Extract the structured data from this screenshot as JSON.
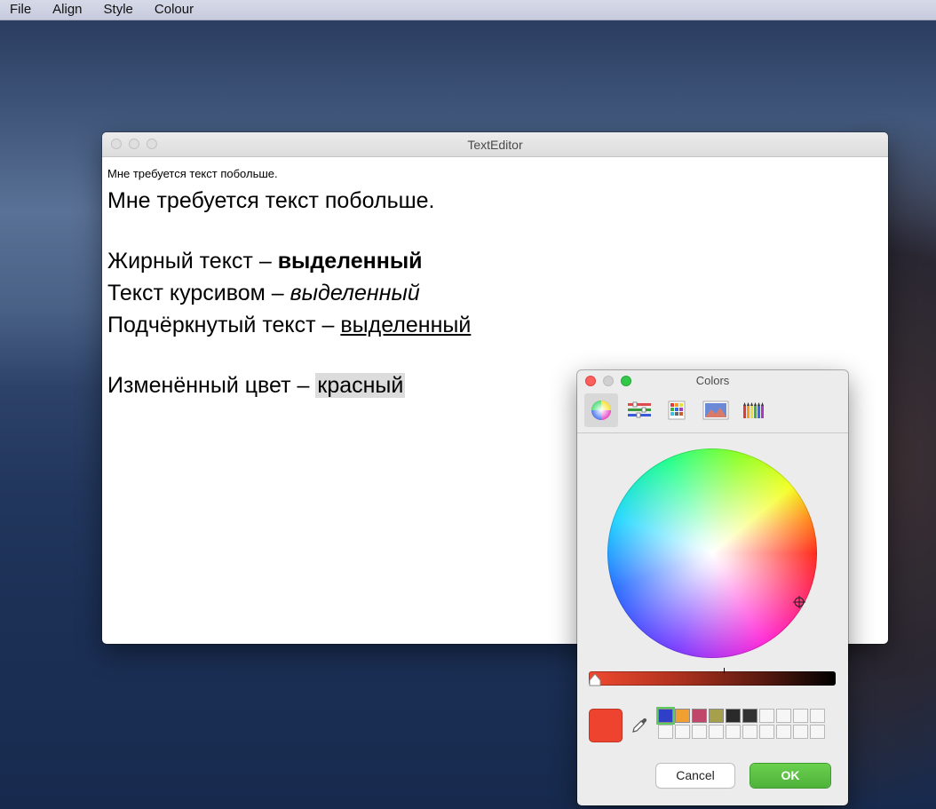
{
  "menubar": {
    "items": [
      "File",
      "Align",
      "Style",
      "Colour"
    ]
  },
  "editor_window": {
    "title": "TextEditor",
    "lines": {
      "small": "Мне требуется текст побольше.",
      "big": "Мне требуется текст побольше.",
      "bold_prefix": "Жирный текст – ",
      "bold_word": "выделенный",
      "italic_prefix": "Текст курсивом – ",
      "italic_word": "выделенный",
      "underline_prefix": "Подчёркнутый текст – ",
      "underline_word": "выделенный",
      "color_prefix": "Изменённый цвет – ",
      "color_word": "красный"
    }
  },
  "colors_panel": {
    "title": "Colors",
    "tabs": [
      "color-wheel",
      "color-sliders",
      "color-palettes",
      "image-palettes",
      "pencils"
    ],
    "selected_tab": "color-wheel",
    "current_color": "#ee432f",
    "swatches": [
      "#2f3fc7",
      "#f0a030",
      "#c0466a",
      "#a6a04a",
      "#2a2a2a",
      "#333333"
    ],
    "cancel_label": "Cancel",
    "ok_label": "OK"
  }
}
